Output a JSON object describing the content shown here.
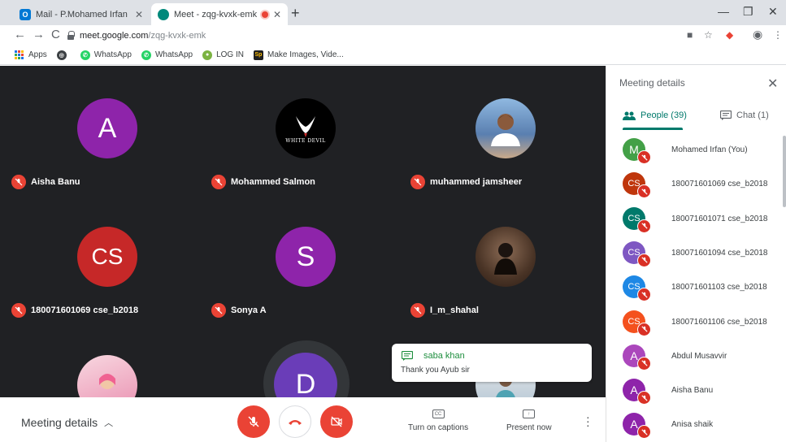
{
  "browser": {
    "tabs": [
      {
        "title": "Mail - P.Mohamed Irfan - Outlook",
        "icon": "outlook-icon",
        "color": "#0078d4"
      },
      {
        "title": "Meet - zqg-kvxk-emk",
        "icon": "meet-icon",
        "color": "#00897b"
      },
      {
        "title": "",
        "icon": "recording-icon",
        "color": "#ea4335"
      }
    ],
    "url_host": "meet.google.com",
    "url_path": "/zqg-kvxk-emk",
    "bookmarks": [
      {
        "label": "Apps",
        "icon": "apps-grid-icon"
      },
      {
        "label": "",
        "icon": "globe-icon"
      },
      {
        "label": "WhatsApp",
        "icon": "whatsapp-icon"
      },
      {
        "label": "WhatsApp",
        "icon": "whatsapp-icon"
      },
      {
        "label": "LOG IN",
        "icon": "login-icon"
      },
      {
        "label": "Make Images, Vide...",
        "icon": "spark-icon"
      }
    ]
  },
  "participants_grid": [
    {
      "name": "Aisha Banu",
      "avatar": "A",
      "color": "#8e24aa"
    },
    {
      "name": "Mohammed Salmon",
      "avatar": "WHITE DEVIL",
      "color": "#000000"
    },
    {
      "name": "muhammed jamsheer",
      "avatar": "photo",
      "color": "#4a90c8"
    },
    {
      "name": "180071601069 cse_b2018",
      "avatar": "CS",
      "color": "#c62828"
    },
    {
      "name": "Sonya A",
      "avatar": "S",
      "color": "#8e24aa"
    },
    {
      "name": "I_m_shahal",
      "avatar": "photo",
      "color": "#6d4c3d"
    },
    {
      "name": "",
      "avatar": "photo",
      "color": "#f3c1d0"
    },
    {
      "name": "",
      "avatar": "D",
      "color": "#6a3db8"
    },
    {
      "name": "",
      "avatar": "photo",
      "color": "#e6e6e6"
    }
  ],
  "toast": {
    "sender": "saba khan",
    "message": "Thank you Ayub sir"
  },
  "bottom_bar": {
    "meeting_details": "Meeting details",
    "captions": "Turn on captions",
    "present": "Present now"
  },
  "panel": {
    "title": "Meeting details",
    "people_tab": "People (39)",
    "chat_tab": "Chat (1)",
    "people": [
      {
        "name": "Mohamed Irfan (You)",
        "initials": "M",
        "color": "#43a047"
      },
      {
        "name": "180071601069 cse_b2018",
        "initials": "CS",
        "color": "#bf360c"
      },
      {
        "name": "180071601071 cse_b2018",
        "initials": "CS",
        "color": "#00796b"
      },
      {
        "name": "180071601094 cse_b2018",
        "initials": "CS",
        "color": "#7e57c2"
      },
      {
        "name": "180071601103 cse_b2018",
        "initials": "CS",
        "color": "#1e88e5"
      },
      {
        "name": "180071601106 cse_b2018",
        "initials": "CS",
        "color": "#f4511e"
      },
      {
        "name": "Abdul Musavvir",
        "initials": "A",
        "color": "#ab47bc"
      },
      {
        "name": "Aisha Banu",
        "initials": "A",
        "color": "#8e24aa"
      },
      {
        "name": "Anisa shaik",
        "initials": "A",
        "color": "#8e24aa"
      }
    ]
  }
}
